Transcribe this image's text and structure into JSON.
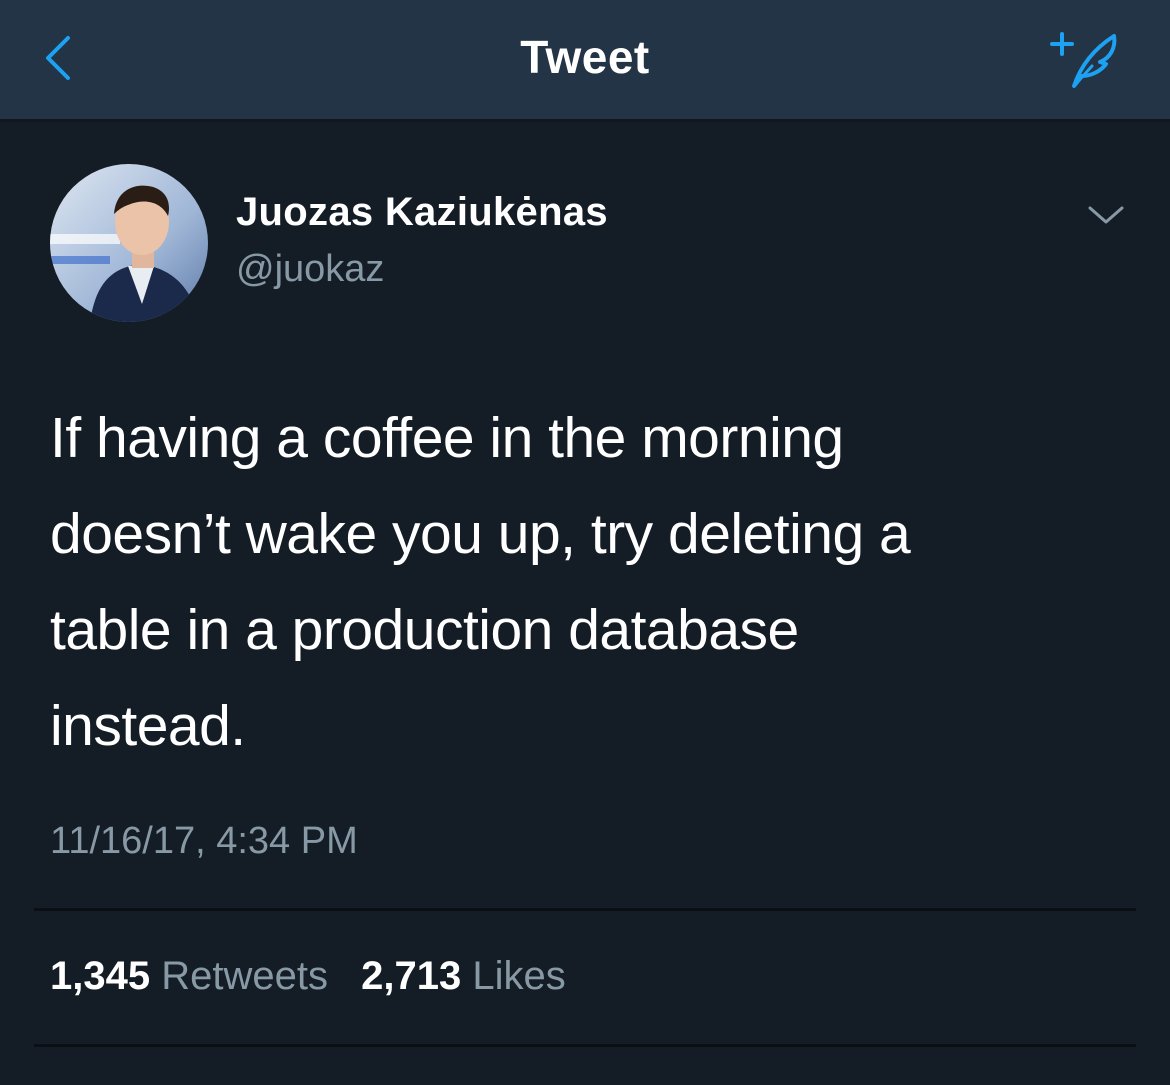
{
  "nav": {
    "title": "Tweet",
    "back_icon": "chevron-left-icon",
    "compose_icon": "compose-tweet-icon"
  },
  "tweet": {
    "author": {
      "display_name": "Juozas Kaziukėnas",
      "handle": "@juokaz"
    },
    "text": "If having a coffee in the morning\ndoesn’t wake you up, try deleting a\ntable in a production database\ninstead.",
    "timestamp": "11/16/17, 4:34 PM",
    "stats": {
      "retweets_count": "1,345",
      "retweets_label": "Retweets",
      "likes_count": "2,713",
      "likes_label": "Likes"
    }
  },
  "colors": {
    "background": "#141d26",
    "navbar": "#243447",
    "accent": "#1da1f2",
    "secondary_text": "#8899a6"
  }
}
